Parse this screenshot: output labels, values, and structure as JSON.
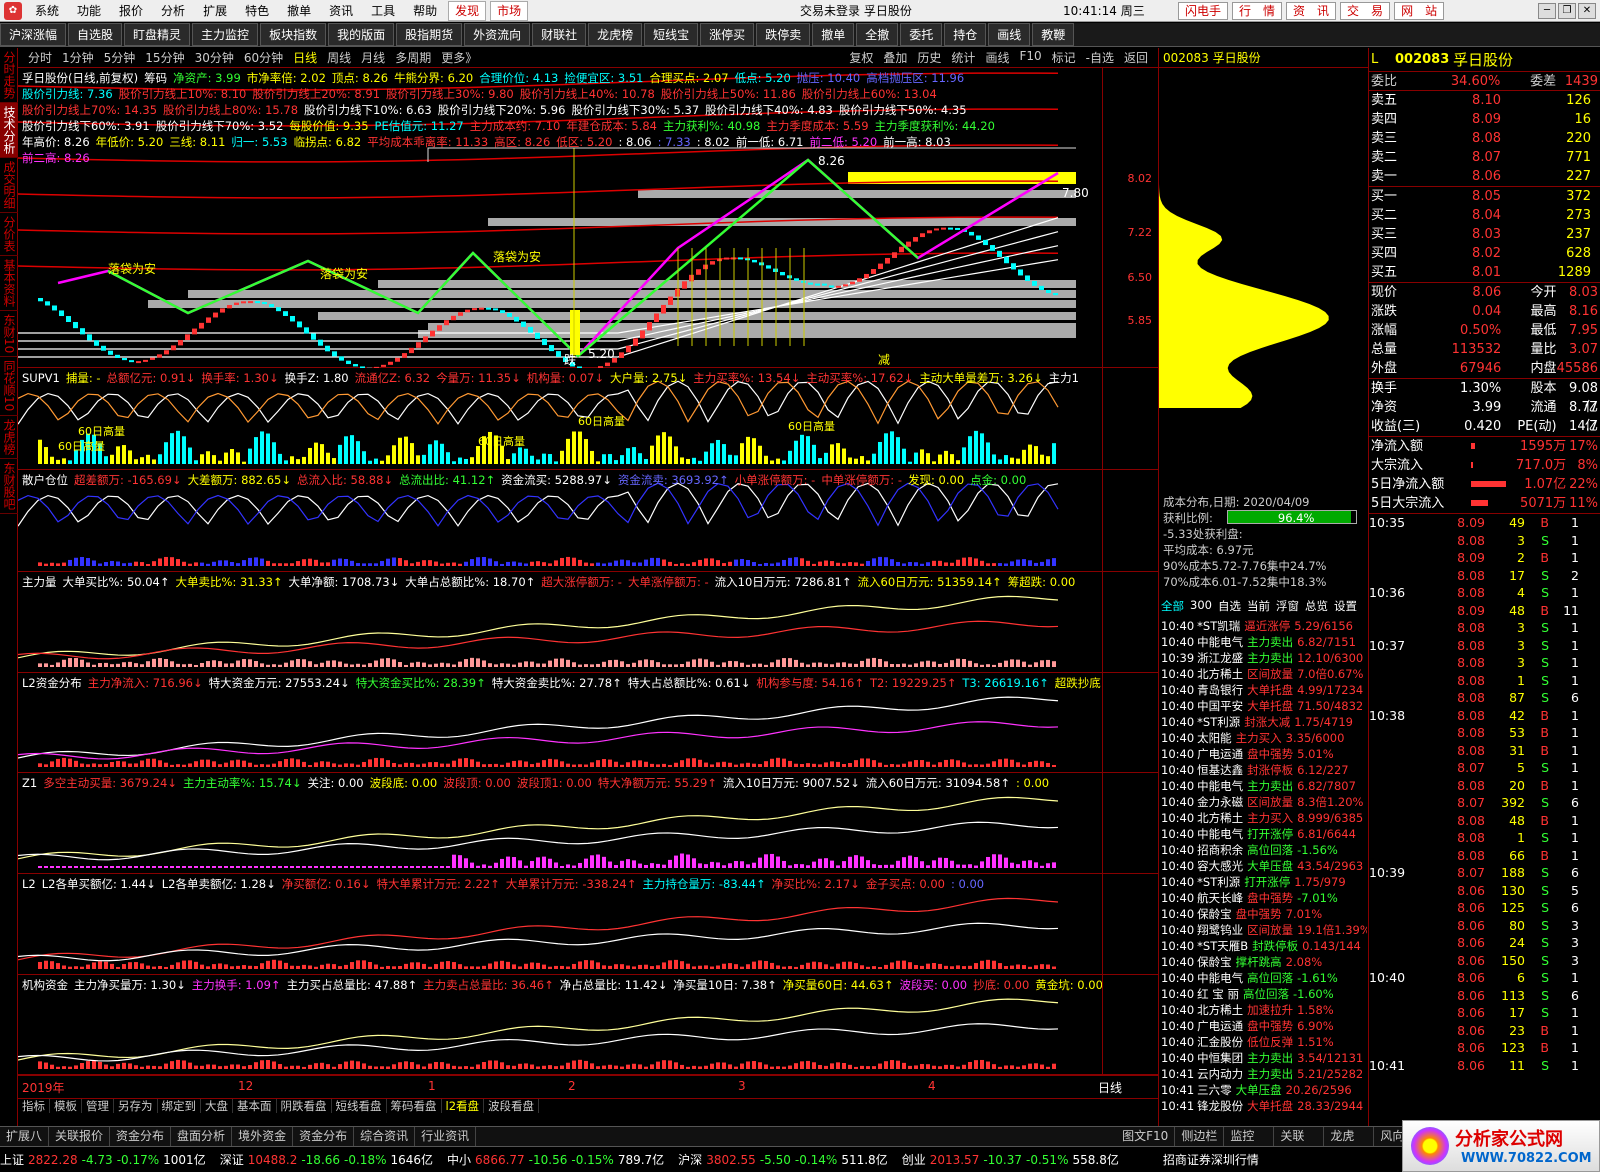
{
  "menubar": {
    "items": [
      "系统",
      "功能",
      "报价",
      "分析",
      "扩展",
      "特色",
      "撤单",
      "资讯",
      "工具",
      "帮助"
    ],
    "hot": [
      "发现",
      "市场"
    ],
    "center": "交易未登录 孚日股份",
    "clock": "10:41:14 周三",
    "rbtns": [
      "闪电手",
      "行　情",
      "资　讯",
      "交　易",
      "网　站"
    ]
  },
  "toolbar": [
    "沪深涨幅",
    "自选股",
    "盯盘精灵",
    "主力监控",
    "板块指数",
    "我的版面",
    "股指期货",
    "外资流向",
    "财联社",
    "龙虎榜",
    "短线宝",
    "涨停买",
    "跌停卖",
    "撤单",
    "全撤",
    "委托",
    "持仓",
    "画线",
    "教鞭"
  ],
  "lefttabs": [
    "分时走势",
    "技术分析",
    "成交明细",
    "分价表",
    "基本资料",
    "东财10",
    "同花顺10",
    "龙虎榜",
    "东财股吧"
  ],
  "periods": [
    "分时",
    "1分钟",
    "5分钟",
    "15分钟",
    "30分钟",
    "60分钟",
    "日线",
    "周线",
    "月线",
    "多周期",
    "更多》"
  ],
  "periodsRight": [
    "复权",
    "叠加",
    "历史",
    "统计",
    "画线",
    "F10",
    "标记",
    "-自选",
    "返回"
  ],
  "main": {
    "title": "孚日股份(日线,前复权)",
    "chip": "筹码",
    "line1": [
      [
        "净资产: 3.99",
        "g"
      ],
      [
        "市净率倍: 2.02",
        "y"
      ],
      [
        "顶点: 8.26",
        "y"
      ],
      [
        "牛熊分界: 6.20",
        "y"
      ],
      [
        "合理价位: 4.13",
        "c"
      ],
      [
        "捡便宜区: 3.51",
        "c"
      ],
      [
        "合理买点: 2.07",
        "y"
      ],
      [
        "低点: 5.20",
        "c"
      ],
      [
        "抛压: 10.40",
        "b"
      ],
      [
        "高档抛压区: 11.96",
        "b"
      ]
    ],
    "line2": [
      [
        "股价引力线: 7.36",
        "c"
      ],
      [
        "股价引力线上10%: 8.10",
        "r"
      ],
      [
        "股价引力线上20%: 8.91",
        "r"
      ],
      [
        "股价引力线上30%: 9.80",
        "r"
      ],
      [
        "股价引力线上40%: 10.78",
        "r"
      ],
      [
        "股价引力线上50%: 11.86",
        "r"
      ],
      [
        "股价引力线上60%: 13.04",
        "r"
      ]
    ],
    "line3": [
      [
        "股价引力线上70%: 14.35",
        "r"
      ],
      [
        "股价引力线上80%: 15.78",
        "r"
      ],
      [
        "股价引力线下10%: 6.63",
        "w"
      ],
      [
        "股价引力线下20%: 5.96",
        "w"
      ],
      [
        "股价引力线下30%: 5.37",
        "w"
      ],
      [
        "股价引力线下40%: 4.83",
        "w"
      ],
      [
        "股价引力线下50%: 4.35",
        "w"
      ]
    ],
    "line4": [
      [
        "股价引力线下60%: 3.91",
        "w"
      ],
      [
        "股价引力线下70%: 3.52",
        "w"
      ],
      [
        "每股价值: 9.35",
        "y"
      ],
      [
        "PE估值元: 11.27",
        "c"
      ],
      [
        "主力成本约: 7.10",
        "r"
      ],
      [
        "年建仓成本: 5.84",
        "r"
      ],
      [
        "主力获利%: 40.98",
        "g"
      ],
      [
        "主力季度成本: 5.59",
        "r"
      ],
      [
        "主力季度获利%: 44.20",
        "g"
      ]
    ],
    "line5": [
      [
        "年高价: 8.26",
        "w"
      ],
      [
        "年低价: 5.20",
        "y"
      ],
      [
        "三线: 8.11",
        "y"
      ],
      [
        "归一: 5.53",
        "c"
      ],
      [
        "临拐点: 6.82",
        "y"
      ],
      [
        "平均成本乖离率: 11.33",
        "r"
      ],
      [
        "高区: 8.26",
        "r"
      ],
      [
        "低区: 5.20",
        "r"
      ],
      [
        ": 8.06",
        "w"
      ],
      [
        ": 7.33",
        "b"
      ],
      [
        ": 8.02",
        "w"
      ],
      [
        "前一低: 6.71",
        "w"
      ],
      [
        "前二低: 5.20",
        "m"
      ],
      [
        "前一高: 8.03",
        "w"
      ]
    ],
    "line6": [
      [
        "前二高: 8.26",
        "m"
      ]
    ],
    "yticks": [
      "8.02",
      "7.22",
      "6.50",
      "5.85"
    ],
    "annotations": [
      "落袋为安",
      "落袋为安",
      "落袋为安",
      "跌",
      "减",
      "8.26",
      "5.20",
      "7.80"
    ]
  },
  "panes": [
    {
      "name": "SUPV1",
      "items": [
        [
          "捕量: -",
          "y"
        ],
        [
          "总额亿元: 0.91↓",
          "r"
        ],
        [
          "换手率: 1.30↓",
          "r"
        ],
        [
          "换手Z: 1.80",
          "w"
        ],
        [
          "流通亿Z: 6.32",
          "r"
        ],
        [
          "今量万: 11.35↓",
          "r"
        ],
        [
          "机构量: 0.07↓",
          "r"
        ],
        [
          "大户量: 2.75↓",
          "y"
        ],
        [
          "主力买率%: 13.54↓",
          "r"
        ],
        [
          "主动买率%: 17.62↓",
          "r"
        ],
        [
          "主动大单量差万: 3.26↓",
          "y"
        ],
        [
          "主力1",
          "w"
        ]
      ],
      "labels": [
        "60日高量",
        "60日高量",
        "60日高量",
        "60日高量",
        "60日高量"
      ]
    },
    {
      "name": "散户仓位",
      "items": [
        [
          "超差额万: -165.69↓",
          "r"
        ],
        [
          "大差额万: 882.65↓",
          "y"
        ],
        [
          "总流入比: 58.88↓",
          "r"
        ],
        [
          "总流出比: 41.12↑",
          "g"
        ],
        [
          "资金流买: 5288.97↓",
          "w"
        ],
        [
          "资金流卖: 3693.92↑",
          "b"
        ],
        [
          "小单涨停额万: -",
          "r"
        ],
        [
          "中单涨停额万: -",
          "r"
        ],
        [
          "发现: 0.00",
          "y"
        ],
        [
          "点金: 0.00",
          "g"
        ]
      ]
    },
    {
      "name": "主力量",
      "items": [
        [
          "大单买比%: 50.04↑",
          "w"
        ],
        [
          "大单卖比%: 31.33↑",
          "y"
        ],
        [
          "大单净额: 1708.73↓",
          "w"
        ],
        [
          "大单占总额比%: 18.70↑",
          "w"
        ],
        [
          "超大涨停额万: -",
          "r"
        ],
        [
          "大单涨停额万: -",
          "r"
        ],
        [
          "流入10日万元: 7286.81↑",
          "w"
        ],
        [
          "流入60日万元: 51359.14↑",
          "y"
        ],
        [
          "筹超跌: 0.00",
          "y"
        ]
      ]
    },
    {
      "name": "L2资金分布",
      "items": [
        [
          "主力净流入: 716.96↓",
          "r"
        ],
        [
          "特大资金万元: 27553.24↓",
          "w"
        ],
        [
          "特大资金买比%: 28.39↑",
          "g"
        ],
        [
          "特大资金卖比%: 27.78↑",
          "w"
        ],
        [
          "特大占总额比%: 0.61↓",
          "w"
        ],
        [
          "机构参与度: 54.16↑",
          "r"
        ],
        [
          "T2: 19229.25↑",
          "r"
        ],
        [
          "T3: 26619.16↑",
          "c"
        ],
        [
          "超跌抄底",
          "y"
        ]
      ]
    },
    {
      "name": "Z1",
      "items": [
        [
          "多空主动买量: 3679.24↓",
          "r"
        ],
        [
          "主力主动率%: 15.74↓",
          "g"
        ],
        [
          "关注: 0.00",
          "w"
        ],
        [
          "波段底: 0.00",
          "y"
        ],
        [
          "波段顶: 0.00",
          "r"
        ],
        [
          "波段顶1: 0.00",
          "r"
        ],
        [
          "特大净额万元: 55.29↑",
          "r"
        ],
        [
          "流入10日万元: 9007.52↓",
          "w"
        ],
        [
          "流入60日万元: 31094.58↑",
          "w"
        ],
        [
          ": 0.00",
          "y"
        ]
      ]
    },
    {
      "name": "L2",
      "items": [
        [
          "L2各单买额亿: 1.44↓",
          "w"
        ],
        [
          "L2各单卖额亿: 1.28↓",
          "w"
        ],
        [
          "净买额亿: 0.16↓",
          "r"
        ],
        [
          "特大单累计万元: 2.22↑",
          "r"
        ],
        [
          "大单累计万元: -338.24↑",
          "r"
        ],
        [
          "主力持仓量万: -83.44↑",
          "c"
        ],
        [
          "净买比%: 2.17↓",
          "r"
        ],
        [
          "金子买点: 0.00",
          "r"
        ],
        [
          ": 0.00",
          "b"
        ]
      ]
    },
    {
      "name": "机构资金",
      "items": [
        [
          "主力净买量万: 1.30↓",
          "w"
        ],
        [
          "主力换手: 1.09↑",
          "m"
        ],
        [
          "主力买占总量比: 47.88↑",
          "w"
        ],
        [
          "主力卖占总量比: 36.46↑",
          "r"
        ],
        [
          "净占总量比: 11.42↓",
          "w"
        ],
        [
          "净买量10日: 7.38↑",
          "w"
        ],
        [
          "净买量60日: 44.63↑",
          "y"
        ],
        [
          "波段买: 0.00",
          "m"
        ],
        [
          "抄底: 0.00",
          "r"
        ],
        [
          "黄金坑: 0.00",
          "y"
        ]
      ]
    }
  ],
  "timeaxis": [
    "2019年",
    "12",
    "1",
    "2",
    "3",
    "4",
    "日线"
  ],
  "chipinfo": {
    "header": "002083 孚日股份",
    "title": "成本分布,日期: 2020/04/09",
    "profit_label": "获利比例:",
    "profit": "96.4%",
    "l1": "-5.33处获利盘:",
    "l2": "平均成本: 6.97元",
    "l3": "90%成本5.72-7.76集中24.7%",
    "l4": "70%成本6.01-7.52集中18.3%"
  },
  "newstabs": [
    "全部",
    "300",
    "自选",
    "当前",
    "浮窗",
    "总览",
    "设置"
  ],
  "news": [
    [
      "10:40",
      "*ST凯瑞",
      "逼近涨停",
      "5.29/6156"
    ],
    [
      "10:40",
      "中能电气",
      "主力卖出",
      "6.82/7151"
    ],
    [
      "10:39",
      "浙江龙盛",
      "主力卖出",
      "12.10/6300"
    ],
    [
      "10:40",
      "北方稀土",
      "区间放量",
      "7.0倍0.67%"
    ],
    [
      "10:40",
      "青岛银行",
      "大单托盘",
      "4.99/17234"
    ],
    [
      "10:40",
      "中国平安",
      "大单托盘",
      "71.50/4832"
    ],
    [
      "10:40",
      "*ST利源",
      "封涨大减",
      "1.75/4719"
    ],
    [
      "10:40",
      "太阳能",
      "主力买入",
      "3.35/6000"
    ],
    [
      "10:40",
      "广电运通",
      "盘中强势",
      "5.01%"
    ],
    [
      "10:40",
      "恒基达鑫",
      "封涨停板",
      "6.12/227"
    ],
    [
      "10:40",
      "中能电气",
      "主力卖出",
      "6.82/7807"
    ],
    [
      "10:40",
      "金力永磁",
      "区间放量",
      "8.3倍1.20%"
    ],
    [
      "10:40",
      "北方稀土",
      "主力买入",
      "8.999/6385"
    ],
    [
      "10:40",
      "中能电气",
      "打开涨停",
      "6.81/6644"
    ],
    [
      "10:40",
      "招商积余",
      "高位回落",
      "-1.56%"
    ],
    [
      "10:40",
      "容大感光",
      "大单压盘",
      "43.54/2963"
    ],
    [
      "10:40",
      "*ST利源",
      "打开涨停",
      "1.75/979"
    ],
    [
      "10:40",
      "航天长峰",
      "盘中强势",
      "-7.01%"
    ],
    [
      "10:40",
      "保龄宝",
      "盘中强势",
      "7.01%"
    ],
    [
      "10:40",
      "翔鹭钨业",
      "区间放量",
      "19.1倍1.39%"
    ],
    [
      "10:40",
      "*ST天雁B",
      "封跌停板",
      "0.143/144"
    ],
    [
      "10:40",
      "保龄宝",
      "撑杆跳高",
      "2.08%"
    ],
    [
      "10:40",
      "中能电气",
      "高位回落",
      "-1.61%"
    ],
    [
      "10:40",
      "红 宝 丽",
      "高位回落",
      "-1.60%"
    ],
    [
      "10:40",
      "北方稀土",
      "加速拉升",
      "1.58%"
    ],
    [
      "10:40",
      "广电运通",
      "盘中强势",
      "6.90%"
    ],
    [
      "10:40",
      "汇金股份",
      "低位反弹",
      "1.51%"
    ],
    [
      "10:40",
      "中恒集团",
      "主力卖出",
      "3.54/12131"
    ],
    [
      "10:41",
      "云内动力",
      "主力卖出",
      "5.21/25282"
    ],
    [
      "10:41",
      "三六零",
      "大单压盘",
      "20.26/2596"
    ],
    [
      "10:41",
      "锋龙股份",
      "大单托盘",
      "28.33/2944"
    ]
  ],
  "quote": {
    "header_l": "L",
    "code": "002083",
    "name": "孚日股份",
    "weibi_label": "委比",
    "weibi": "34.60%",
    "weicha_label": "委差",
    "weicha": "1439",
    "sells": [
      [
        "卖五",
        "8.10",
        "126"
      ],
      [
        "卖四",
        "8.09",
        "16"
      ],
      [
        "卖三",
        "8.08",
        "220"
      ],
      [
        "卖二",
        "8.07",
        "771"
      ],
      [
        "卖一",
        "8.06",
        "227"
      ]
    ],
    "buys": [
      [
        "买一",
        "8.05",
        "372"
      ],
      [
        "买二",
        "8.04",
        "273"
      ],
      [
        "买三",
        "8.03",
        "237"
      ],
      [
        "买四",
        "8.02",
        "628"
      ],
      [
        "买五",
        "8.01",
        "1289"
      ]
    ],
    "stats": [
      [
        "现价",
        "8.06",
        "今开",
        "8.03"
      ],
      [
        "涨跌",
        "0.04",
        "最高",
        "8.16"
      ],
      [
        "涨幅",
        "0.50%",
        "最低",
        "7.95"
      ],
      [
        "总量",
        "113532",
        "量比",
        "3.07"
      ],
      [
        "外盘",
        "67946",
        "内盘",
        "45586"
      ]
    ],
    "stats2": [
      [
        "换手",
        "1.30%",
        "股本",
        "9.08亿"
      ],
      [
        "净资",
        "3.99",
        "流通",
        "8.77亿"
      ],
      [
        "收益(三)",
        "0.420",
        "PE(动)",
        "14.7"
      ]
    ],
    "flows": [
      [
        "净流入额",
        "1595万",
        "17%"
      ],
      [
        "大宗流入",
        "717.0万",
        "8%"
      ],
      [
        "5日净流入额",
        "1.07亿",
        "22%"
      ],
      [
        "5日大宗流入",
        "5071万",
        "11%"
      ]
    ],
    "ticks": [
      [
        "10:35",
        "8.09",
        "49",
        "B",
        "1"
      ],
      [
        "",
        "8.08",
        "3",
        "S",
        "1"
      ],
      [
        "",
        "8.09",
        "2",
        "B",
        "1"
      ],
      [
        "",
        "8.08",
        "17",
        "S",
        "2"
      ],
      [
        "10:36",
        "8.08",
        "4",
        "S",
        "1"
      ],
      [
        "",
        "8.09",
        "48",
        "B",
        "11"
      ],
      [
        "",
        "8.08",
        "3",
        "S",
        "1"
      ],
      [
        "10:37",
        "8.08",
        "3",
        "S",
        "1"
      ],
      [
        "",
        "8.08",
        "3",
        "S",
        "1"
      ],
      [
        "",
        "8.08",
        "1",
        "S",
        "1"
      ],
      [
        "",
        "8.08",
        "87",
        "S",
        "6"
      ],
      [
        "10:38",
        "8.08",
        "42",
        "B",
        "1"
      ],
      [
        "",
        "8.08",
        "53",
        "B",
        "1"
      ],
      [
        "",
        "8.08",
        "31",
        "B",
        "1"
      ],
      [
        "",
        "8.07",
        "5",
        "S",
        "1"
      ],
      [
        "",
        "8.08",
        "20",
        "B",
        "1"
      ],
      [
        "",
        "8.07",
        "392",
        "S",
        "6"
      ],
      [
        "",
        "8.08",
        "48",
        "B",
        "1"
      ],
      [
        "",
        "8.08",
        "1",
        "S",
        "1"
      ],
      [
        "",
        "8.08",
        "66",
        "B",
        "1"
      ],
      [
        "10:39",
        "8.07",
        "188",
        "S",
        "6"
      ],
      [
        "",
        "8.06",
        "130",
        "S",
        "5"
      ],
      [
        "",
        "8.06",
        "125",
        "S",
        "6"
      ],
      [
        "",
        "8.06",
        "80",
        "S",
        "3"
      ],
      [
        "",
        "8.06",
        "24",
        "S",
        "3"
      ],
      [
        "",
        "8.06",
        "150",
        "S",
        "3"
      ],
      [
        "10:40",
        "8.06",
        "6",
        "S",
        "1"
      ],
      [
        "",
        "8.06",
        "113",
        "S",
        "6"
      ],
      [
        "",
        "8.06",
        "17",
        "S",
        "1"
      ],
      [
        "",
        "8.06",
        "23",
        "B",
        "1"
      ],
      [
        "",
        "8.06",
        "123",
        "B",
        "1"
      ],
      [
        "10:41",
        "8.06",
        "11",
        "S",
        "1"
      ]
    ]
  },
  "bottomtabs": {
    "row1": [
      "指标",
      "模板",
      "管理",
      "另存为",
      "绑定到",
      "大盘",
      "基本面",
      "阴跌看盘",
      "短线看盘",
      "筹码看盘",
      "l2看盘",
      "波段看盘"
    ],
    "row2": [
      "扩展八",
      "关联报价",
      "资金分布",
      "盘面分析",
      "境外资金",
      "资金分布",
      "综合资讯",
      "行业资讯"
    ],
    "right": [
      "图文F10",
      "侧边栏"
    ]
  },
  "extabs": [
    "监控",
    "关联",
    "龙虎",
    "风向"
  ],
  "status": [
    [
      "上证",
      "2822.28",
      "-4.73",
      "-0.17%",
      "1001亿"
    ],
    [
      "深证",
      "10488.2",
      "-18.66",
      "-0.18%",
      "1646亿"
    ],
    [
      "中小",
      "6866.77",
      "-10.56",
      "-0.15%",
      "789.7亿"
    ],
    [
      "沪深",
      "3802.55",
      "-5.50",
      "-0.14%",
      "511.8亿"
    ],
    [
      "创业",
      "2013.57",
      "-10.37",
      "-0.51%",
      "558.8亿"
    ]
  ],
  "status_tail": "招商证券深圳行情",
  "brand": {
    "t1": "分析家公式网",
    "t2": "WWW.70822.COM"
  },
  "colors": {
    "up": "#ff3333",
    "down": "#33ff33",
    "gold": "#ffff00",
    "magenta": "#ff33ff",
    "cyan": "#00ffff"
  }
}
